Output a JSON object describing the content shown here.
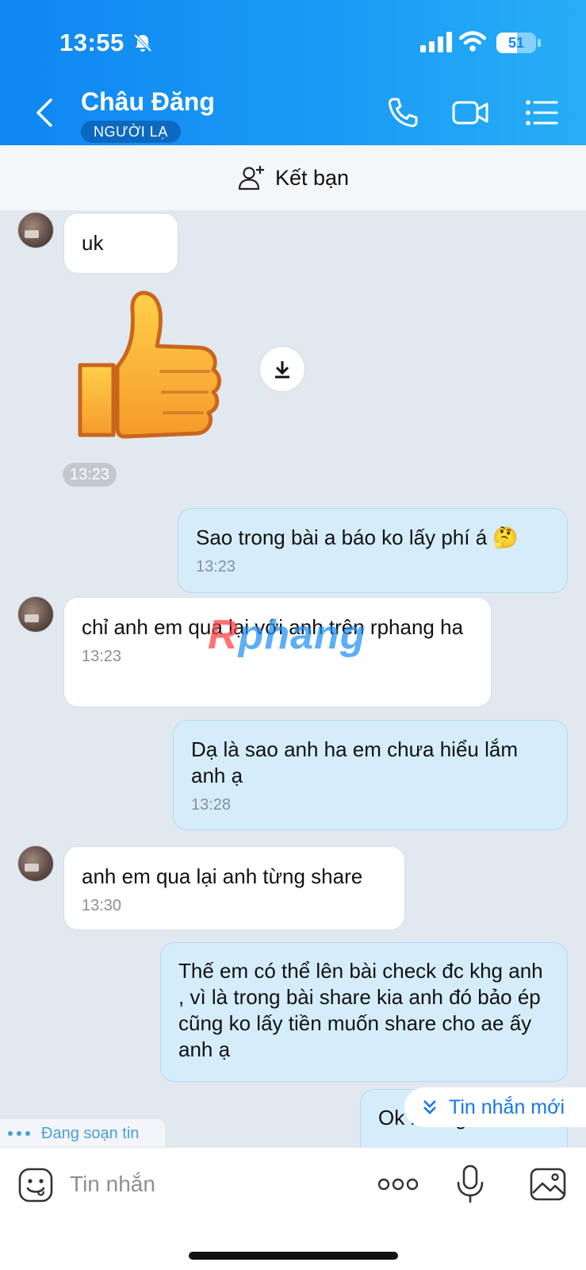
{
  "status_bar": {
    "time": "13:55",
    "battery": "51"
  },
  "header": {
    "name": "Châu Đăng",
    "badge": "NGƯỜI LẠ"
  },
  "add_friend": {
    "label": "Kết bạn"
  },
  "watermark": {
    "part1": "R",
    "part2": "phang"
  },
  "messages": [
    {
      "side": "in",
      "text": "uk"
    },
    {
      "side": "in",
      "type": "sticker",
      "sticker": "thumbs-up",
      "time": "13:23"
    },
    {
      "side": "out",
      "text": "Sao trong bài a báo ko lấy phí á 🤔",
      "time": "13:23"
    },
    {
      "side": "in",
      "text": "chỉ anh em qua lại với anh trên rphang ha",
      "time": "13:23"
    },
    {
      "side": "out",
      "text": "Dạ là sao anh ha em chưa hiểu lắm anh ạ",
      "time": "13:28"
    },
    {
      "side": "in",
      "text": "anh em qua lại anh từng share",
      "time": "13:30"
    },
    {
      "side": "out",
      "text": "Thế em có thể lên bài check đc khg anh , vì là trong bài share kia anh đó bảo ép cũng ko lấy tiền muốn share cho ae ấy anh ạ"
    },
    {
      "side": "out",
      "text": "Ok không anh ha"
    }
  ],
  "new_messages_label": "Tin nhắn mới",
  "typing_label": "Đang soạn tin",
  "composer": {
    "placeholder": "Tin nhắn"
  },
  "colors": {
    "header": "#0f86f2",
    "outgoing_bubble": "#d5edfb",
    "incoming_bubble": "#ffffff",
    "chat_bg": "#e2e8f0",
    "accent": "#1677e8"
  }
}
